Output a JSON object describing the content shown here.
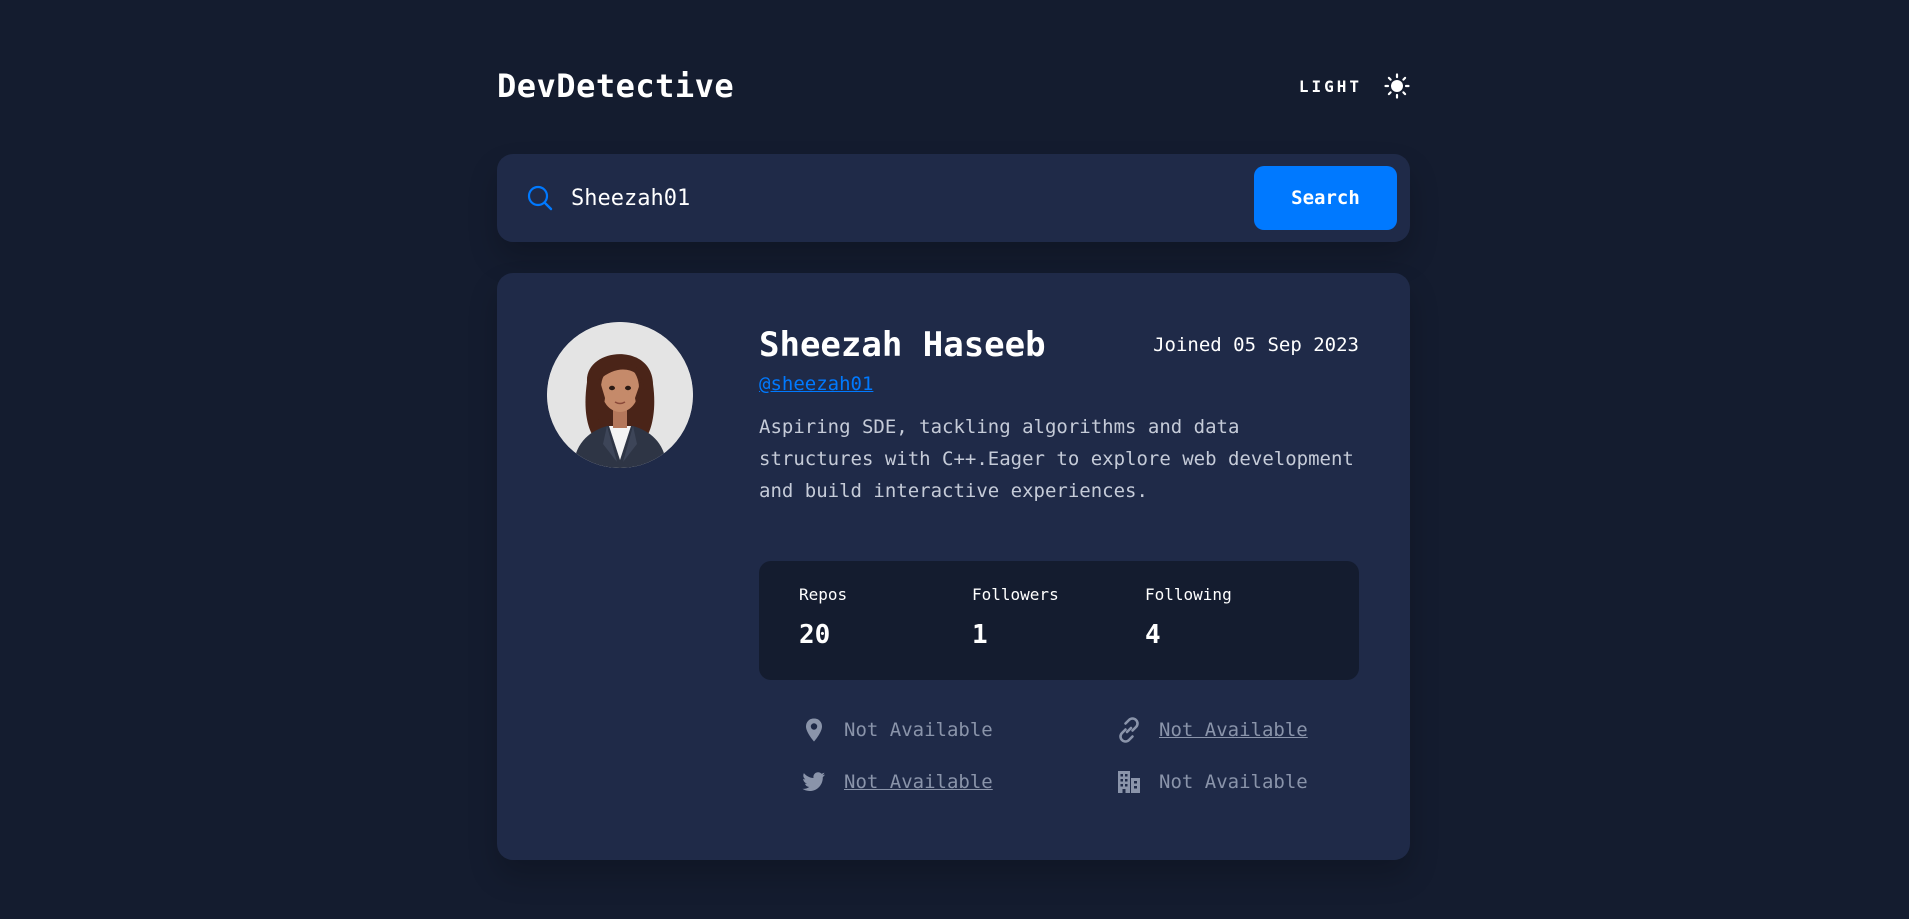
{
  "app": {
    "title": "DevDetective",
    "theme_toggle_label": "LIGHT",
    "theme_icon": "sun-icon"
  },
  "search": {
    "icon": "search-icon",
    "value": "Sheezah01",
    "placeholder": "Search GitHub username...",
    "button_label": "Search"
  },
  "profile": {
    "name": "Sheezah Haseeb",
    "joined": "Joined 05 Sep 2023",
    "username": "@sheezah01",
    "bio": "Aspiring SDE, tackling algorithms and data structures with C++.Eager to explore web development and build interactive experiences."
  },
  "stats": [
    {
      "label": "Repos",
      "value": "20"
    },
    {
      "label": "Followers",
      "value": "1"
    },
    {
      "label": "Following",
      "value": "4"
    }
  ],
  "links": {
    "location": {
      "icon": "location-pin-icon",
      "text": "Not Available"
    },
    "blog": {
      "icon": "link-icon",
      "text": "Not Available"
    },
    "twitter": {
      "icon": "twitter-icon",
      "text": "Not Available"
    },
    "company": {
      "icon": "building-icon",
      "text": "Not Available"
    }
  },
  "colors": {
    "background": "#141c2f",
    "card": "#1f2a48",
    "accent": "#0079ff",
    "muted_text": "#8a94aa"
  }
}
